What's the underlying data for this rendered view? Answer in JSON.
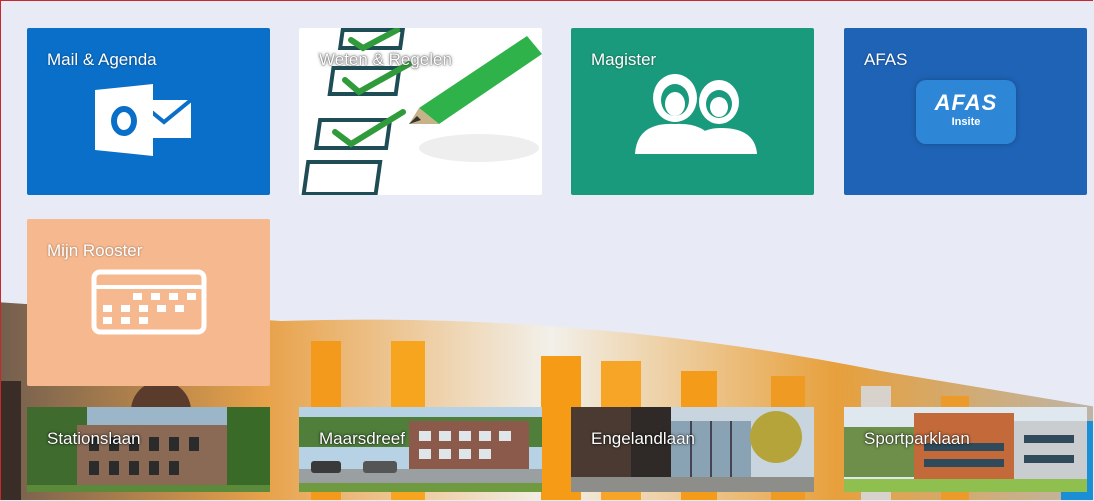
{
  "tiles": [
    {
      "label": "Mail & Agenda",
      "icon": "outlook-icon",
      "color": "#0a6fc9"
    },
    {
      "label": "Weten & Regelen",
      "icon": "checklist-icon",
      "color": "#ffffff"
    },
    {
      "label": "Magister",
      "icon": "users-icon",
      "color": "#1a9a7c"
    },
    {
      "label": "AFAS",
      "icon": "afas-insite-logo",
      "color": "#1f63b6"
    },
    {
      "label": "Mijn Rooster",
      "icon": "calendar-icon",
      "color": "#f6b88e"
    }
  ],
  "afas_logo": {
    "brand": "AFAS",
    "sub": "Insite"
  },
  "locations": [
    {
      "label": "Stationslaan"
    },
    {
      "label": "Maarsdreef"
    },
    {
      "label": "Engelandlaan"
    },
    {
      "label": "Sportparklaan"
    }
  ]
}
